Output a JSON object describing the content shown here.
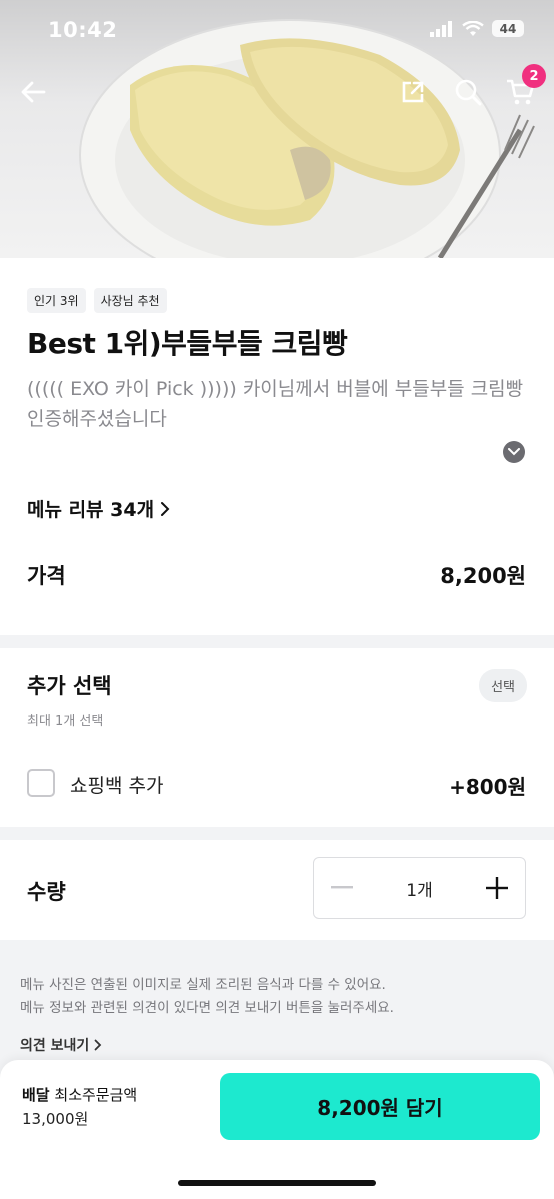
{
  "status_bar": {
    "time": "10:42",
    "battery": "44"
  },
  "header": {
    "cart_count": "2"
  },
  "product": {
    "badges": [
      "인기 3위",
      "사장님 추천"
    ],
    "title": "Best 1위)부들부들 크림빵",
    "description": "((((( EXO 카이 Pick ))))) 카이님께서 버블에 부들부들 크림빵 인증해주셨습니다",
    "review_link": "메뉴 리뷰 34개",
    "price_label": "가격",
    "price_value": "8,200원"
  },
  "options": {
    "title": "추가 선택",
    "subtitle": "최대 1개 선택",
    "tag": "선택",
    "items": [
      {
        "label": "쇼핑백 추가",
        "price": "+800원",
        "checked": false
      }
    ]
  },
  "quantity": {
    "label": "수량",
    "value": "1개"
  },
  "notice": {
    "line1": "메뉴 사진은 연출된 이미지로 실제 조리된 음식과 다를 수 있어요.",
    "line2": "메뉴 정보와 관련된 의견이 있다면 의견 보내기 버튼을 눌러주세요.",
    "feedback_label": "의견 보내기"
  },
  "footer": {
    "delivery_label": "배달",
    "min_order_label": "최소주문금액",
    "min_order_value": "13,000원",
    "add_button": "8,200원 담기"
  },
  "colors": {
    "accent": "#1de9cf",
    "badge": "#f0307f"
  }
}
